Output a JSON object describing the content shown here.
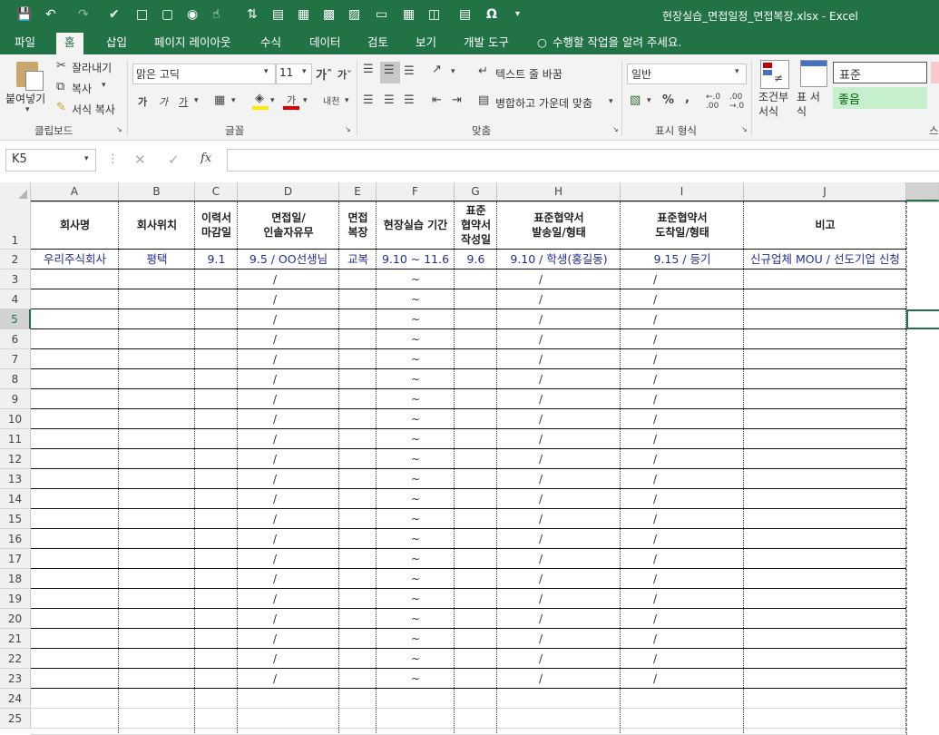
{
  "window": {
    "title": "현장실습_면접일정_면접복장.xlsx - Excel"
  },
  "tabs": [
    "파일",
    "홈",
    "삽입",
    "페이지 레이아웃",
    "수식",
    "데이터",
    "검토",
    "보기",
    "개발 도구"
  ],
  "tell_me": "수행할 작업을 알려 주세요.",
  "ribbon": {
    "clipboard": {
      "paste": "붙여넣기",
      "cut": "잘라내기",
      "copy": "복사",
      "format_painter": "서식 복사",
      "group": "클립보드"
    },
    "font": {
      "name": "맑은 고딕",
      "size": "11",
      "bold": "가",
      "italic": "가",
      "underline": "가",
      "font_color": "가",
      "phonetic": "내천",
      "group": "글꼴"
    },
    "alignment": {
      "wrap": "텍스트 줄 바꿈",
      "merge": "병합하고 가운데 맞춤",
      "group": "맞춤"
    },
    "number": {
      "format": "일반",
      "percent": "%",
      "comma": ",",
      "group": "표시 형식"
    },
    "styles": {
      "conditional": "조건부 서식",
      "table": "표 서식",
      "normal": "표준",
      "good": "좋음",
      "group": "스"
    }
  },
  "formula_bar": {
    "name_box": "K5",
    "fx": "fx",
    "value": ""
  },
  "columns": [
    "A",
    "B",
    "C",
    "D",
    "E",
    "F",
    "G",
    "H",
    "I",
    "J"
  ],
  "header_row": {
    "A": "회사명",
    "B": "회사위치",
    "C": "이력서\n마감일",
    "D": "면접일/\n인솔자유무",
    "E": "면접\n복장",
    "F": "현장실습 기간",
    "G": "표준\n협약서\n작성일",
    "H": "표준협약서\n발송일/형태",
    "I": "표준협약서\n도착일/형태",
    "J": "비고"
  },
  "row2": {
    "A": "우리주식회사",
    "B": "평택",
    "C": "9.1",
    "D": "9.5 /  OO선생님",
    "E": "교복",
    "F": "9.10 ~ 11.6",
    "G": "9.6",
    "H": "9.10 /  학생(홍길동)",
    "I": "9.15 /  등기",
    "J": "신규업체 MOU / 선도기업 신청"
  },
  "template_marks": {
    "D": "/",
    "F": "~",
    "H": "/",
    "I": "/"
  },
  "row_numbers": [
    "1",
    "2",
    "3",
    "4",
    "5",
    "6",
    "7",
    "8",
    "9",
    "10",
    "11",
    "12",
    "13",
    "14",
    "15",
    "16",
    "17",
    "18",
    "19",
    "20",
    "21",
    "22",
    "23",
    "24",
    "25"
  ],
  "colors": {
    "excel_green": "#217346",
    "text_blue": "#1f2f9e",
    "selection": "#217346"
  }
}
